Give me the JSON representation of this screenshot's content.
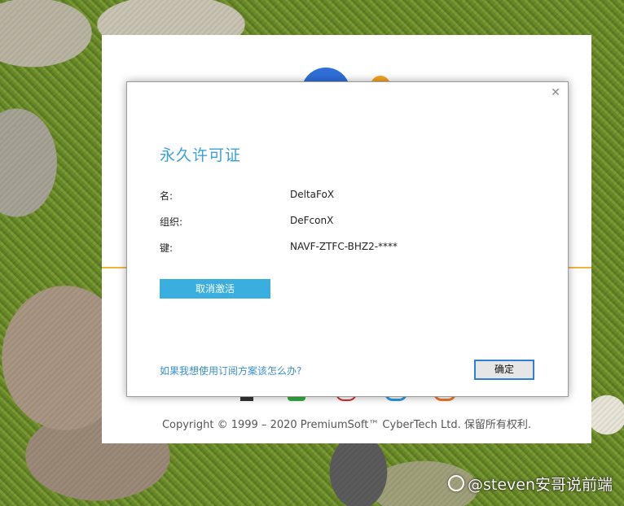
{
  "background_window": {
    "copyright": "Copyright © 1999 – 2020 PremiumSoft™ CyberTech Ltd. 保留所有权利.",
    "accent_color": "#f3b43f"
  },
  "dialog": {
    "title": "永久许可证",
    "close_icon": "close-icon",
    "fields": [
      {
        "label": "名:",
        "value": "DeltaFoX"
      },
      {
        "label": "组织:",
        "value": "DeFconX"
      },
      {
        "label": "键:",
        "value": "NAVF-ZTFC-BHZ2-****"
      }
    ],
    "deactivate_label": "取消激活",
    "subscription_link": "如果我想使用订阅方案该怎么办?",
    "ok_label": "确定",
    "accent_color": "#3aaede"
  },
  "watermark": {
    "text": "@steven安哥说前端"
  }
}
